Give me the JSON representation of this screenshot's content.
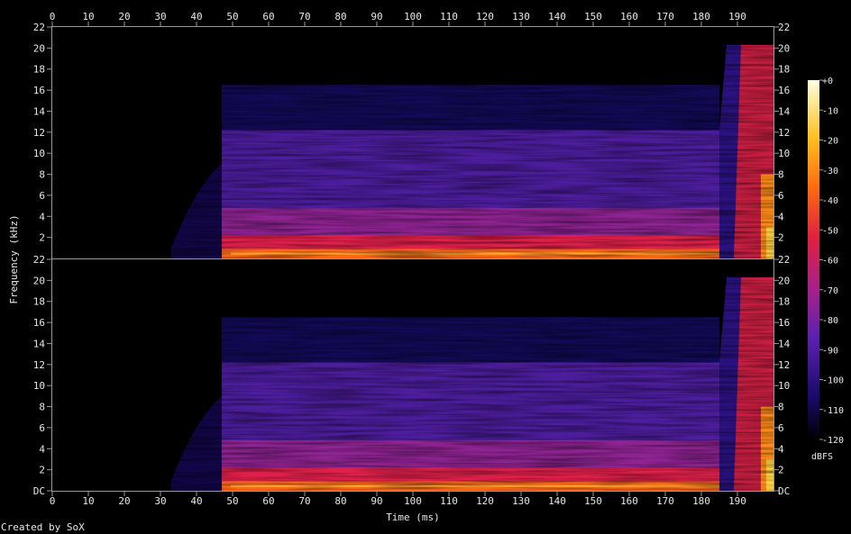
{
  "chart_data": {
    "type": "heatmap",
    "subtype": "spectrogram",
    "channels": 2,
    "xlabel": "Time (ms)",
    "ylabel": "Frequency (kHz)",
    "xlim": [
      0,
      200
    ],
    "ylim": [
      0,
      22
    ],
    "x_ticks": [
      0,
      10,
      20,
      30,
      40,
      50,
      60,
      70,
      80,
      90,
      100,
      110,
      120,
      130,
      140,
      150,
      160,
      170,
      180,
      190
    ],
    "y_ticks_top": [
      "22",
      "20",
      "18",
      "16",
      "14",
      "12",
      "10",
      "8",
      "6",
      "4",
      "2"
    ],
    "y_ticks_bottom": [
      "22",
      "20",
      "18",
      "16",
      "14",
      "12",
      "10",
      "8",
      "6",
      "4",
      "2",
      "DC"
    ],
    "colorbar": {
      "label": "dBFS",
      "range": [
        -120,
        0
      ],
      "ticks": [
        "+0",
        "-10",
        "-20",
        "-30",
        "-40",
        "-50",
        "-60",
        "-70",
        "-80",
        "-90",
        "-100",
        "-110",
        "-120"
      ],
      "colors": [
        "#000000",
        "#1a0a6b",
        "#5a20b0",
        "#a8208a",
        "#e02040",
        "#ff6a10",
        "#ffc020",
        "#ffffe0"
      ]
    },
    "content_regions": {
      "onset_ms": 47,
      "sparse_onset_ms": 33,
      "band_split_khz": 12.2,
      "upper_band_top_khz": 16.5,
      "burst_start_ms": 185,
      "burst_top_khz": 20.3
    },
    "credit": "Created by SoX"
  }
}
